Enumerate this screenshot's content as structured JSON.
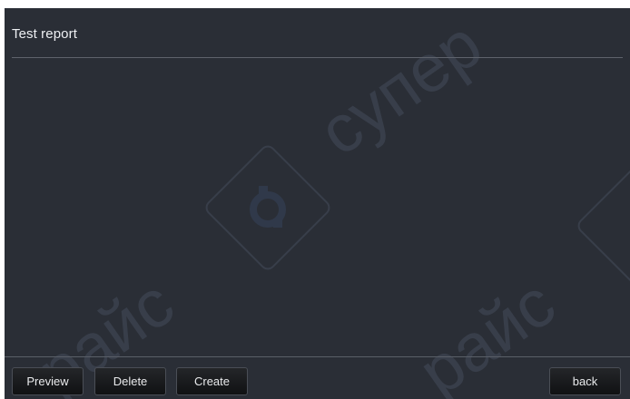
{
  "header": {
    "title": "Test report"
  },
  "toolbar": {
    "preview_label": "Preview",
    "delete_label": "Delete",
    "create_label": "Create",
    "back_label": "back"
  },
  "watermark": {
    "text_top": "супер",
    "text_bottom_left": "райс",
    "text_bottom_right": "райс"
  },
  "colors": {
    "background": "#2a2e36",
    "divider": "#5e636c",
    "text": "#eef0f3",
    "button_bg": "#17191c"
  },
  "icons": {
    "watermark_logo": "gear-logo-icon"
  }
}
